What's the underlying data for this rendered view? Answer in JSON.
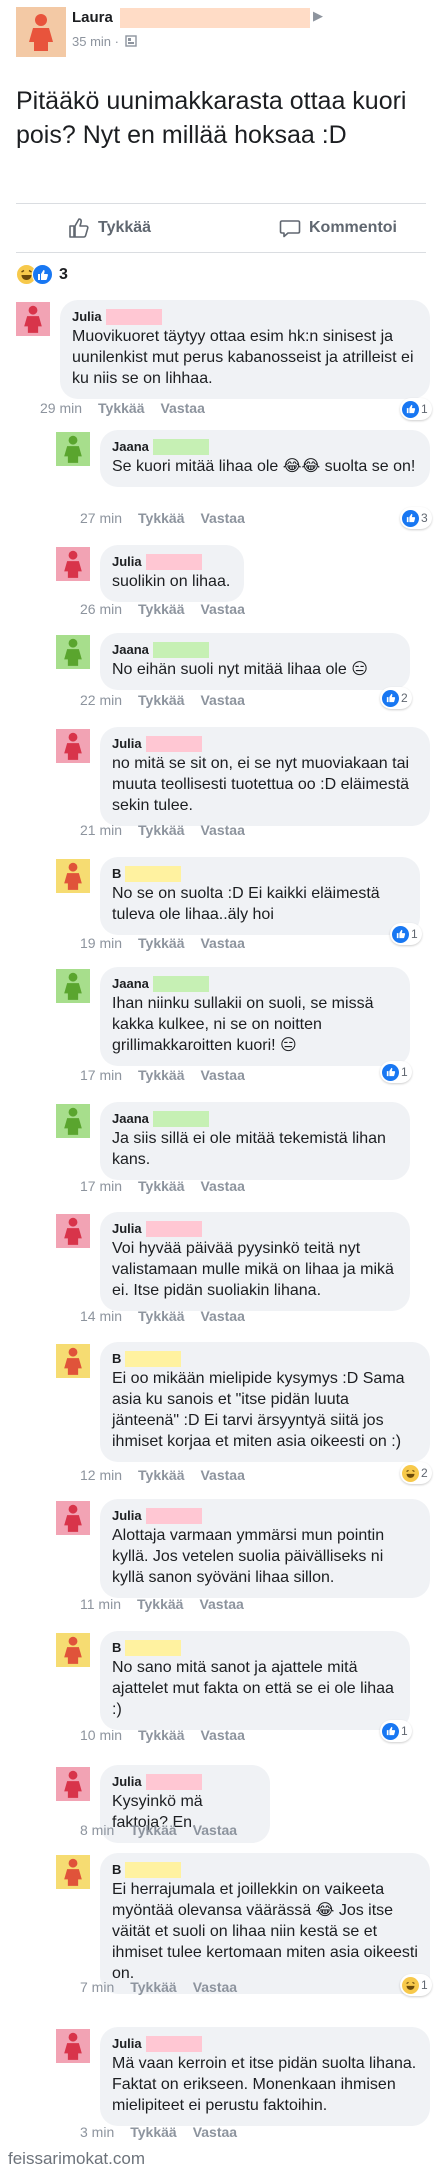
{
  "colors": {
    "author_redact": "#ffdcc6",
    "julia": "#ffc7d3",
    "jaana": "#c6f0b4",
    "b": "#fff2a0",
    "avatar_laura": "#f3c9a5",
    "avatar_julia": "#f2a3b4",
    "avatar_jaana": "#a7de8c",
    "avatar_b": "#f6dc72",
    "like_blue": "#1877f2"
  },
  "post": {
    "author": "Laura",
    "meta": "35 min ·",
    "text": "Pitääkö uunimakkarasta ottaa kuori pois? Nyt en millää hoksaa :D"
  },
  "actions": {
    "like": "Tykkää",
    "comment": "Kommentoi"
  },
  "reactions": {
    "count": "3"
  },
  "comments": [
    {
      "name": "Julia",
      "text": "Muovikuoret täytyy ottaa esim hk:n sinisest ja uunilenkist mut perus kabanosseist ja atrilleist ei ku niis se on lihhaa.",
      "time": "29 min",
      "like": "Tykkää",
      "reply": "Vastaa",
      "reactions": "1"
    },
    {
      "name": "Jaana",
      "text": "Se kuori mitää lihaa ole 😂😂 suolta se on!",
      "time": "27 min",
      "like": "Tykkää",
      "reply": "Vastaa",
      "reactions": "3"
    },
    {
      "name": "Julia",
      "text": "suolikin on lihaa.",
      "time": "26 min",
      "like": "Tykkää",
      "reply": "Vastaa"
    },
    {
      "name": "Jaana",
      "text": "No eihän suoli nyt mitää lihaa ole 😑",
      "time": "22 min",
      "like": "Tykkää",
      "reply": "Vastaa",
      "reactions": "2"
    },
    {
      "name": "Julia",
      "text": "no mitä se sit on, ei se nyt muoviakaan tai muuta teollisesti tuotettua oo :D eläimestä sekin tulee.",
      "time": "21 min",
      "like": "Tykkää",
      "reply": "Vastaa"
    },
    {
      "name": "B",
      "text": "No se on suolta :D Ei kaikki eläimestä tuleva ole lihaa..äly hoi",
      "time": "19 min",
      "like": "Tykkää",
      "reply": "Vastaa",
      "reactions": "1"
    },
    {
      "name": "Jaana",
      "text": "Ihan niinku sullakii on suoli, se missä kakka kulkee, ni se on noitten grillimakkaroitten kuori! 😑",
      "time": "17 min",
      "like": "Tykkää",
      "reply": "Vastaa",
      "reactions": "1"
    },
    {
      "name": "Jaana",
      "text": "Ja siis sillä ei ole mitää tekemistä lihan kans.",
      "time": "17 min",
      "like": "Tykkää",
      "reply": "Vastaa"
    },
    {
      "name": "Julia",
      "text": "Voi hyvää päivää pyysinkö teitä nyt valistamaan mulle mikä on lihaa ja mikä ei. Itse pidän suoliakin lihana.",
      "time": "14 min",
      "like": "Tykkää",
      "reply": "Vastaa"
    },
    {
      "name": "B",
      "text": "Ei oo mikään mielipide kysymys :D Sama asia ku sanois et \"itse pidän luuta jänteenä\" :D Ei tarvi ärsyyntyä siitä jos ihmiset korjaa et miten asia oikeesti on :)",
      "time": "12 min",
      "like": "Tykkää",
      "reply": "Vastaa",
      "reactions": "2"
    },
    {
      "name": "Julia",
      "text": "Alottaja varmaan ymmärsi mun pointin kyllä. Jos vetelen suolia päivälliseks ni kyllä sanon syöväni lihaa sillon.",
      "time": "11 min",
      "like": "Tykkää",
      "reply": "Vastaa"
    },
    {
      "name": "B",
      "text": "No sano mitä sanot ja ajattele mitä ajattelet mut fakta on että se ei ole lihaa :)",
      "time": "10 min",
      "like": "Tykkää",
      "reply": "Vastaa",
      "reactions": "1"
    },
    {
      "name": "Julia",
      "text": "Kysyinkö mä faktoja? En.",
      "time": "8 min",
      "like": "Tykkää",
      "reply": "Vastaa"
    },
    {
      "name": "B",
      "text": "Ei herrajumala et joillekkin on vaikeeta myöntää olevansa väärässä 😂 Jos itse väität et suoli on lihaa niin kestä se et ihmiset tulee kertomaan miten asia oikeesti on.",
      "time": "7 min",
      "like": "Tykkää",
      "reply": "Vastaa",
      "reactions": "1"
    },
    {
      "name": "Julia",
      "text": "Mä vaan kerroin et itse pidän suolta lihana. Faktat on erikseen. Monenkaan ihmisen mielipiteet ei perustu faktoihin.",
      "time": "3 min",
      "like": "Tykkää",
      "reply": "Vastaa"
    }
  ],
  "watermark": "feissarimokat.com"
}
